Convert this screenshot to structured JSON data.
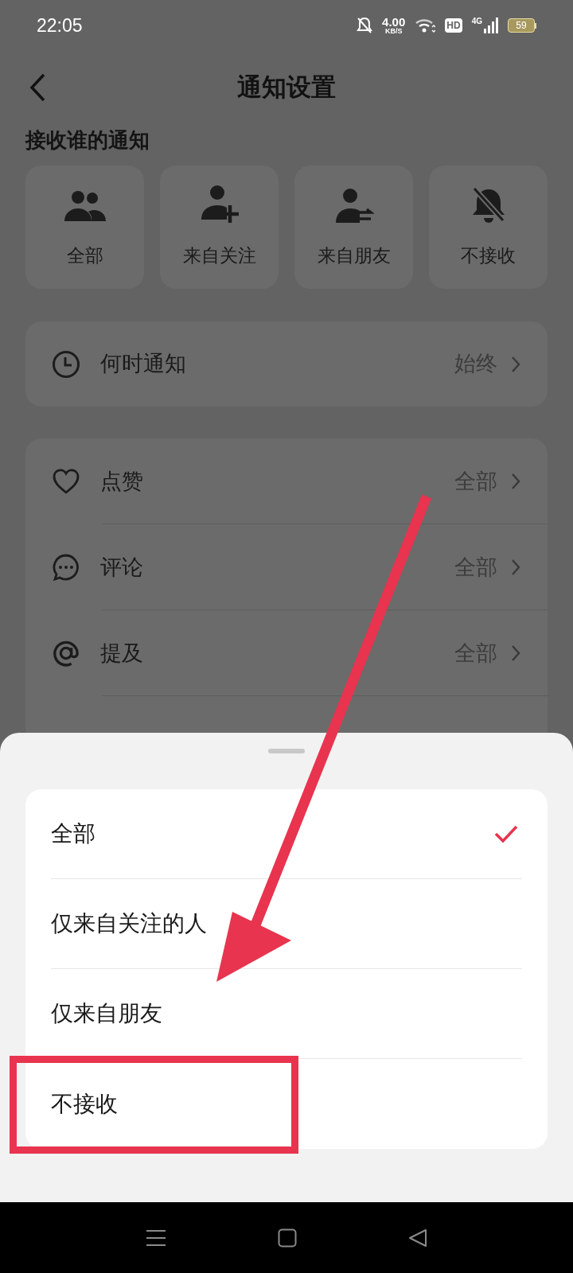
{
  "status_bar": {
    "time": "22:05",
    "speed": "4.00",
    "speed_unit": "KB/S",
    "hd": "HD",
    "network": "4G",
    "battery": "59"
  },
  "header": {
    "title": "通知设置"
  },
  "section_title": "接收谁的通知",
  "audience": [
    {
      "kind": "group",
      "label": "全部"
    },
    {
      "kind": "follow",
      "label": "来自关注"
    },
    {
      "kind": "friends",
      "label": "来自朋友"
    },
    {
      "kind": "off",
      "label": "不接收"
    }
  ],
  "when": {
    "label": "何时通知",
    "value": "始终"
  },
  "settings": [
    {
      "kind": "like",
      "label": "点赞",
      "value": "全部"
    },
    {
      "kind": "comment",
      "label": "评论",
      "value": "全部"
    },
    {
      "kind": "mention",
      "label": "提及",
      "value": "全部"
    }
  ],
  "sheet": {
    "options": [
      {
        "label": "全部",
        "selected": true
      },
      {
        "label": "仅来自关注的人",
        "selected": false
      },
      {
        "label": "仅来自朋友",
        "selected": false
      },
      {
        "label": "不接收",
        "selected": false
      }
    ]
  }
}
